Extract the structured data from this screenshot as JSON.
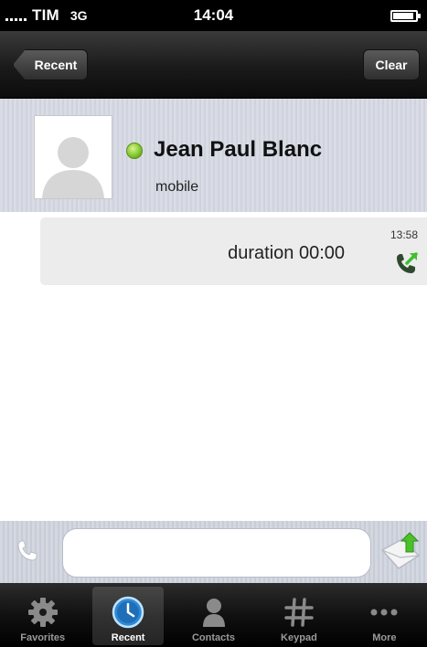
{
  "status_bar": {
    "carrier": "TIM",
    "network": "3G",
    "time": "14:04"
  },
  "nav_bar": {
    "back_label": "Recent",
    "clear_label": "Clear"
  },
  "contact": {
    "name": "Jean Paul Blanc",
    "label": "mobile",
    "presence_color": "#7cc12a"
  },
  "call": {
    "duration": "duration 00:00",
    "time": "13:58",
    "icon": "outgoing-call-icon",
    "icon_colors": {
      "handset": "#2e4a2e",
      "arrow": "#3fbf2f"
    }
  },
  "composer": {
    "left_icon": "phone-icon",
    "input_value": "",
    "send_icon": "send-envelope-icon"
  },
  "tab_bar": {
    "items": [
      {
        "label": "Favorites",
        "icon": "gear-icon",
        "active": false
      },
      {
        "label": "Recent",
        "icon": "clock-icon",
        "active": true
      },
      {
        "label": "Contacts",
        "icon": "person-icon",
        "active": false
      },
      {
        "label": "Keypad",
        "icon": "keypad-icon",
        "active": false
      },
      {
        "label": "More",
        "icon": "more-dots-icon",
        "active": false
      }
    ]
  }
}
